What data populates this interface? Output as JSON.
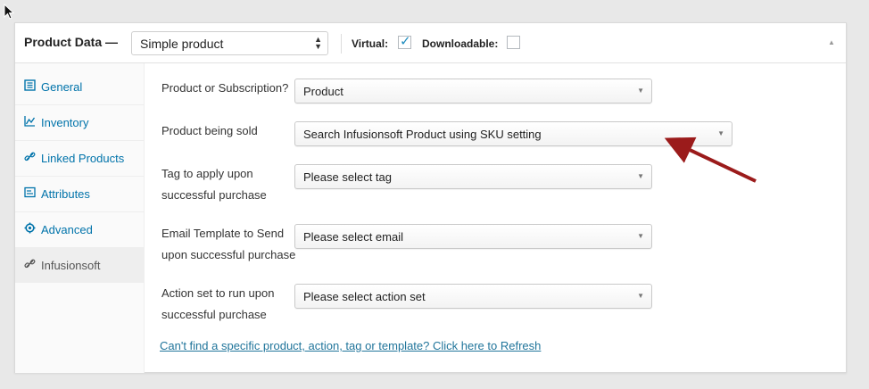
{
  "header": {
    "title": "Product Data —",
    "product_type": "Simple product",
    "virtual_label": "Virtual:",
    "virtual_checked": true,
    "downloadable_label": "Downloadable:",
    "downloadable_checked": false
  },
  "tabs": [
    {
      "label": "General",
      "icon": "general-icon"
    },
    {
      "label": "Inventory",
      "icon": "inventory-icon"
    },
    {
      "label": "Linked Products",
      "icon": "link-icon"
    },
    {
      "label": "Attributes",
      "icon": "attributes-icon"
    },
    {
      "label": "Advanced",
      "icon": "gear-icon"
    },
    {
      "label": "Infusionsoft",
      "icon": "link-icon",
      "active": true
    }
  ],
  "fields": [
    {
      "label": "Product or Subscription?",
      "value": "Product"
    },
    {
      "label": "Product being sold",
      "value": "Search Infusionsoft Product using SKU setting"
    },
    {
      "label_line1": "Tag to apply upon",
      "label_line2": "successful purchase",
      "value": "Please select tag"
    },
    {
      "label_line1": "Email Template to Send",
      "label_line2": "upon successful purchase",
      "value": "Please select email"
    },
    {
      "label_line1": "Action set to run upon",
      "label_line2": "successful purchase",
      "value": "Please select action set"
    }
  ],
  "refresh_link": "Can't find a specific product, action, tag or template? Click here to Refresh",
  "colors": {
    "link": "#0073aa",
    "annotation_arrow": "#9b1b1b"
  }
}
